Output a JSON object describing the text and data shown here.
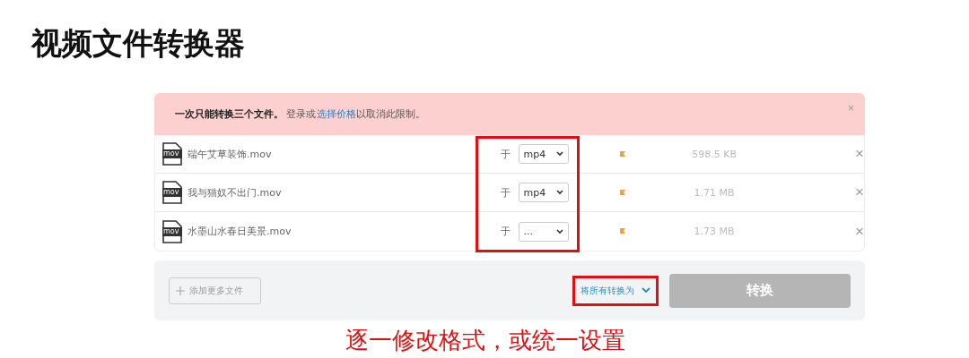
{
  "title": "视频文件转换器",
  "alert": {
    "message": "**一次只能转换三个文件。** 登录或",
    "link": "选择价格",
    "suffix": "以取消此限制。",
    "close": "×"
  },
  "files": [
    {
      "type_label": "mov",
      "name": "端午艾草装饰.mov",
      "prefix": "于",
      "format": "mp4",
      "size": "598.5 KB",
      "remove": "×"
    },
    {
      "type_label": "mov",
      "name": "我与猫奴不出门.mov",
      "prefix": "于",
      "format": "mp4",
      "size": "1.71 MB",
      "remove": "×"
    },
    {
      "type_label": "mov",
      "name": "水墨山水春日美景.mov",
      "prefix": "于",
      "format": "...",
      "size": "1.73 MB",
      "remove": "×"
    }
  ],
  "footer": {
    "add_button": "添加更多文件",
    "convert_all": "将所有转换为",
    "convert_button": {
      "label": "转换",
      "disabled": true
    }
  },
  "annotation": {
    "caption": "逐一修改格式，或统一设置"
  }
}
